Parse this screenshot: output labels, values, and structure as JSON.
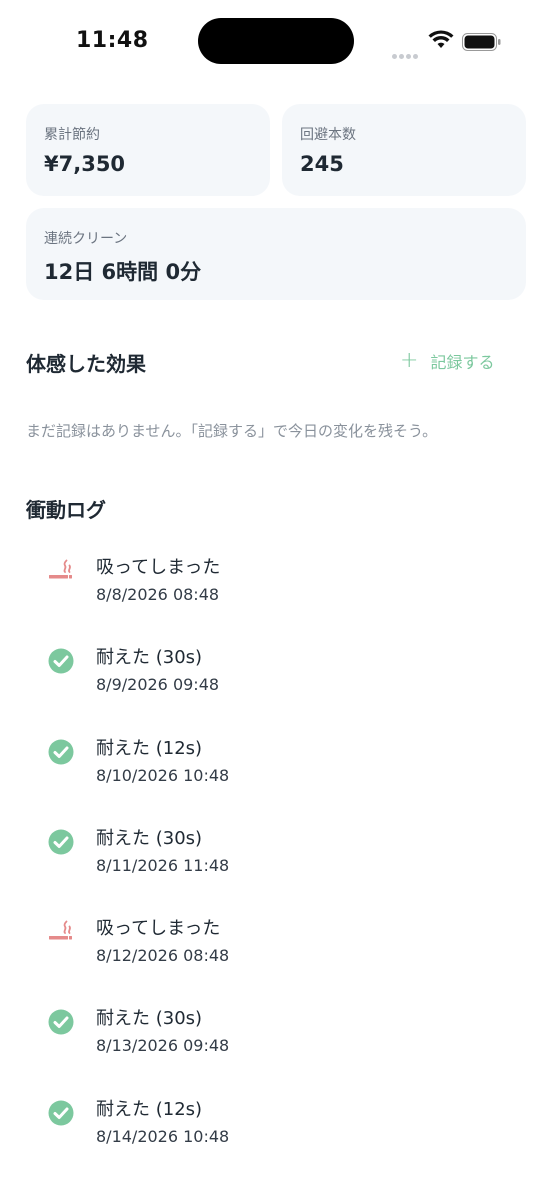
{
  "status_bar": {
    "time": "11:48"
  },
  "stats": {
    "savings": {
      "label": "累計節約",
      "value": "¥7,350"
    },
    "avoided": {
      "label": "回避本数",
      "value": "245"
    },
    "streak": {
      "label": "連続クリーン",
      "value": "12日 6時間 0分"
    }
  },
  "effects": {
    "title": "体感した効果",
    "record_label": "記録する",
    "empty_message": "まだ記録はありません。「記録する」で今日の変化を残そう。"
  },
  "log": {
    "title": "衝動ログ",
    "items": [
      {
        "type": "smoked",
        "icon": "smoking-icon",
        "text": "吸ってしまった",
        "date": "8/8/2026 08:48"
      },
      {
        "type": "resisted",
        "icon": "check-circle-icon",
        "text": "耐えた (30s)",
        "date": "8/9/2026 09:48"
      },
      {
        "type": "resisted",
        "icon": "check-circle-icon",
        "text": "耐えた (12s)",
        "date": "8/10/2026 10:48"
      },
      {
        "type": "resisted",
        "icon": "check-circle-icon",
        "text": "耐えた (30s)",
        "date": "8/11/2026 11:48"
      },
      {
        "type": "smoked",
        "icon": "smoking-icon",
        "text": "吸ってしまった",
        "date": "8/12/2026 08:48"
      },
      {
        "type": "resisted",
        "icon": "check-circle-icon",
        "text": "耐えた (30s)",
        "date": "8/13/2026 09:48"
      },
      {
        "type": "resisted",
        "icon": "check-circle-icon",
        "text": "耐えた (12s)",
        "date": "8/14/2026 10:48"
      }
    ]
  },
  "colors": {
    "accent_green": "#7cc89e",
    "smoked_red": "#e58a8a",
    "card_bg": "#f4f7fa"
  }
}
